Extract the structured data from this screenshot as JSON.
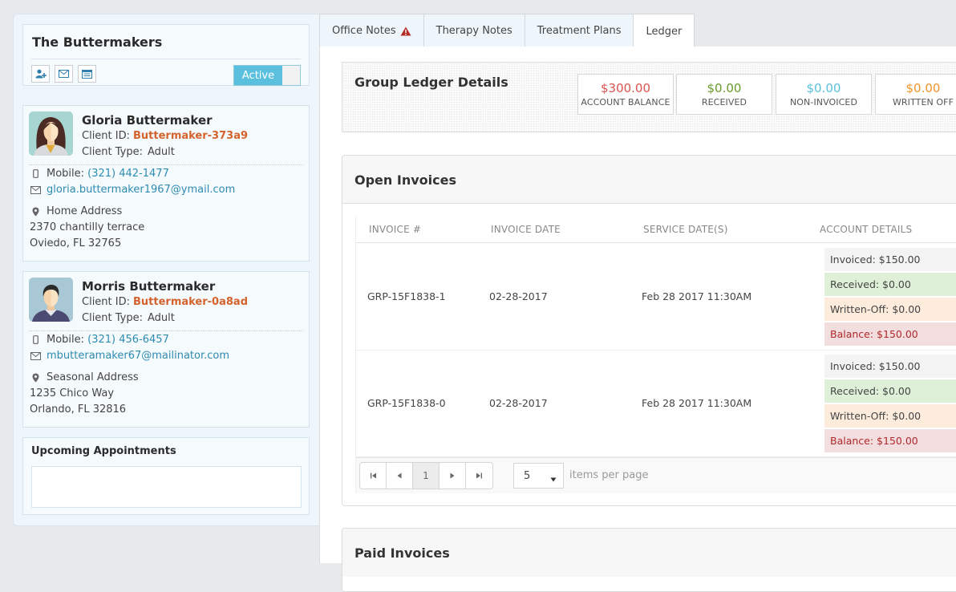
{
  "sidebar": {
    "family": {
      "title": "The Buttermakers",
      "actions": [
        {
          "icon": "add-user-icon"
        },
        {
          "icon": "envelope-icon"
        },
        {
          "icon": "list-card-icon"
        }
      ],
      "status_toggle": "Active"
    },
    "clients": [
      {
        "name": "Gloria Buttermaker",
        "client_id_label": "Client ID:",
        "client_id": "Buttermaker-373a9",
        "client_type_label": "Client Type:",
        "client_type": "Adult",
        "mobile_label": "Mobile:",
        "mobile": "(321) 442-1477",
        "email": "gloria.buttermaker1967@ymail.com",
        "address_label": "Home Address",
        "address_line1": "2370 chantilly terrace",
        "address_line2": "Oviedo, FL 32765",
        "avatar": "female-avatar"
      },
      {
        "name": "Morris Buttermaker",
        "client_id_label": "Client ID:",
        "client_id": "Buttermaker-0a8ad",
        "client_type_label": "Client Type:",
        "client_type": "Adult",
        "mobile_label": "Mobile:",
        "mobile": "(321) 456-6457",
        "email": "mbutteramaker67@mailinator.com",
        "address_label": "Seasonal Address",
        "address_line1": "1235 Chico Way",
        "address_line2": "Orlando, FL 32816",
        "avatar": "male-avatar"
      }
    ],
    "appointments": {
      "title": "Upcoming Appointments"
    }
  },
  "tabs": [
    {
      "label": "Office Notes",
      "has_warning": true
    },
    {
      "label": "Therapy Notes"
    },
    {
      "label": "Treatment Plans"
    },
    {
      "label": "Ledger",
      "active": true
    }
  ],
  "ledger": {
    "title": "Group Ledger Details",
    "stats": [
      {
        "value": "$300.00",
        "caption": "ACCOUNT BALANCE",
        "color": "#d9534f"
      },
      {
        "value": "$0.00",
        "caption": "RECEIVED",
        "color": "#6a9a2c"
      },
      {
        "value": "$0.00",
        "caption": "NON-INVOICED",
        "color": "#5bc0de"
      },
      {
        "value": "$0.00",
        "caption": "WRITTEN OFF",
        "color": "#f0932b"
      }
    ]
  },
  "open_invoices": {
    "title": "Open Invoices",
    "columns": [
      "INVOICE #",
      "INVOICE DATE",
      "SERVICE DATE(S)",
      "ACCOUNT DETAILS"
    ],
    "rows": [
      {
        "invoice_no": "GRP-15F1838-1",
        "invoice_date": "02-28-2017",
        "service_date": "Feb 28 2017 11:30AM",
        "invoiced": "Invoiced: $150.00",
        "received": "Received: $0.00",
        "written_off": "Written-Off: $0.00",
        "balance": "Balance: $150.00"
      },
      {
        "invoice_no": "GRP-15F1838-0",
        "invoice_date": "02-28-2017",
        "service_date": "Feb 28 2017 11:30AM",
        "invoiced": "Invoiced: $150.00",
        "received": "Received: $0.00",
        "written_off": "Written-Off: $0.00",
        "balance": "Balance: $150.00"
      }
    ],
    "pager": {
      "current_page": "1",
      "page_size": "5",
      "page_size_label": "items per page"
    }
  },
  "paid_invoices": {
    "title": "Paid Invoices"
  }
}
